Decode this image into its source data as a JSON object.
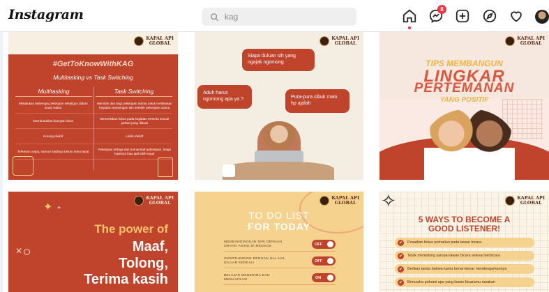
{
  "app": {
    "logo": "Instagram"
  },
  "search": {
    "value": "kag"
  },
  "nav": {
    "messages_badge": "8",
    "icons": [
      "home-icon",
      "messenger-icon",
      "new-post-icon",
      "explore-icon",
      "activity-heart-icon",
      "profile-avatar"
    ]
  },
  "brand": {
    "line1": "KAPAL API",
    "line2": "GLOBAL"
  },
  "posts": {
    "p1": {
      "hashtag": "#GetToKnowWithKAG",
      "subtitle": "Multitasking vs Task Switching",
      "col_left": "Multitasking",
      "col_right": "Task Switching",
      "rows": [
        [
          "Melakukan beberapa pekerjaan sekaligus dalam suatu waktu",
          "Memilah dan bagi pekerjaan utama untuk melakukan kegiatan sampingan lain setelah pekerjaan utama"
        ],
        [
          "Membutuhkan banyak fokus",
          "Memerlukan fokus pada kegiatan tertentu sesuai jadwal yang dibuat"
        ],
        [
          "Kurang efektif",
          "Lebih efektif"
        ],
        [
          "Terkesan cepat, namun hasilnya belum tentu tepat",
          "Pekerjaan terbagi dan menambah pekerjaan, tetapi hasilnya bisa jadi lebih tepat"
        ]
      ]
    },
    "p2": {
      "bubble1": "Siapa duluan sih yang ngajak ngomong",
      "bubble2": "Aduh harus ngomong apa ya ?",
      "bubble3": "Pura-pura sibuk main hp ajalah"
    },
    "p3": {
      "line1": "TIPS MEMBANGUN",
      "line2": "LINGKAR",
      "line3": "PERTEMANAN",
      "line4": "YANG POSITIF"
    },
    "p4": {
      "line1": "The power of",
      "line2": "Maaf,",
      "line3": "Tolong,",
      "line4": "Terima kasih"
    },
    "p5": {
      "title1": "TO DO LIST",
      "title2": "FOR TODAY",
      "items": [
        {
          "text": "MEMBANDINGKAN DIRI DENGAN ORANG ASING DI MEDSOS",
          "state": "OFF"
        },
        {
          "text": "OVERTHINKING DENGAN HAL-HAL DILUAR KENDALI",
          "state": "OFF"
        },
        {
          "text": "BELAJAR MENERIMA DAN MEMAAFKAN",
          "state": "ON"
        }
      ]
    },
    "p6": {
      "title1": "5 WAYS TO BECOME A",
      "title2": "GOOD LISTENER!",
      "items": [
        "Pusatkan fokus perhatian pada lawan bicara",
        "Tidak memotong sampai lawan bicara selesai berbicara",
        "Berikan tanda bahwa kamu benar-benar mendengarkannya",
        "Berusaha pahami apa yang lawan bicaramu rasakan"
      ]
    }
  },
  "colors": {
    "rust": "#c0432b",
    "cream": "#f6efe2",
    "salmon": "#d9573f",
    "peach": "#f6d28f",
    "accent": "#ff3040"
  }
}
